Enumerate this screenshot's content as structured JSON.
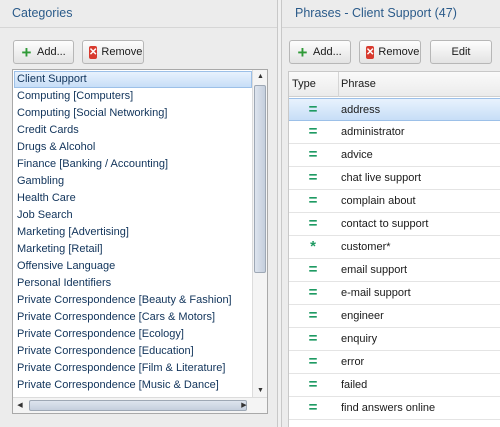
{
  "categories_panel": {
    "title": "Categories",
    "add_label": "Add...",
    "remove_label": "Remove",
    "items": [
      "Client Support",
      "Computing [Computers]",
      "Computing [Social  Networking]",
      "Credit Cards",
      "Drugs & Alcohol",
      "Finance [Banking / Accounting]",
      "Gambling",
      "Health Care",
      "Job Search",
      "Marketing [Advertising]",
      "Marketing [Retail]",
      "Offensive Language",
      "Personal Identifiers",
      "Private Correspondence [Beauty & Fashion]",
      "Private Correspondence [Cars & Motors]",
      "Private Correspondence [Ecology]",
      "Private Correspondence [Education]",
      "Private Correspondence [Film & Literature]",
      "Private Correspondence [Music & Dance]"
    ],
    "selected_index": 0
  },
  "phrases_panel": {
    "title": "Phrases - Client Support (47)",
    "add_label": "Add...",
    "remove_label": "Remove",
    "edit_label": "Edit",
    "columns": {
      "type": "Type",
      "phrase": "Phrase"
    },
    "rows": [
      {
        "type": "exact",
        "glyph": "=",
        "phrase": "address"
      },
      {
        "type": "exact",
        "glyph": "=",
        "phrase": "administrator"
      },
      {
        "type": "exact",
        "glyph": "=",
        "phrase": "advice"
      },
      {
        "type": "exact",
        "glyph": "=",
        "phrase": "chat live support"
      },
      {
        "type": "exact",
        "glyph": "=",
        "phrase": "complain about"
      },
      {
        "type": "exact",
        "glyph": "=",
        "phrase": "contact to support"
      },
      {
        "type": "wildcard",
        "glyph": "*",
        "phrase": "customer*"
      },
      {
        "type": "exact",
        "glyph": "=",
        "phrase": "email support"
      },
      {
        "type": "exact",
        "glyph": "=",
        "phrase": "e-mail support"
      },
      {
        "type": "exact",
        "glyph": "=",
        "phrase": "engineer"
      },
      {
        "type": "exact",
        "glyph": "=",
        "phrase": "enquiry"
      },
      {
        "type": "exact",
        "glyph": "=",
        "phrase": "error"
      },
      {
        "type": "exact",
        "glyph": "=",
        "phrase": "failed"
      },
      {
        "type": "exact",
        "glyph": "=",
        "phrase": "find answers online"
      }
    ],
    "selected_index": 0
  },
  "colors": {
    "title_blue": "#2b5b8a",
    "type_green": "#1e9a62",
    "remove_red": "#d83a2e",
    "add_green": "#2f9a37",
    "selection": "#c7def7"
  },
  "icons": {
    "add": "plus-icon",
    "remove": "x-icon"
  }
}
